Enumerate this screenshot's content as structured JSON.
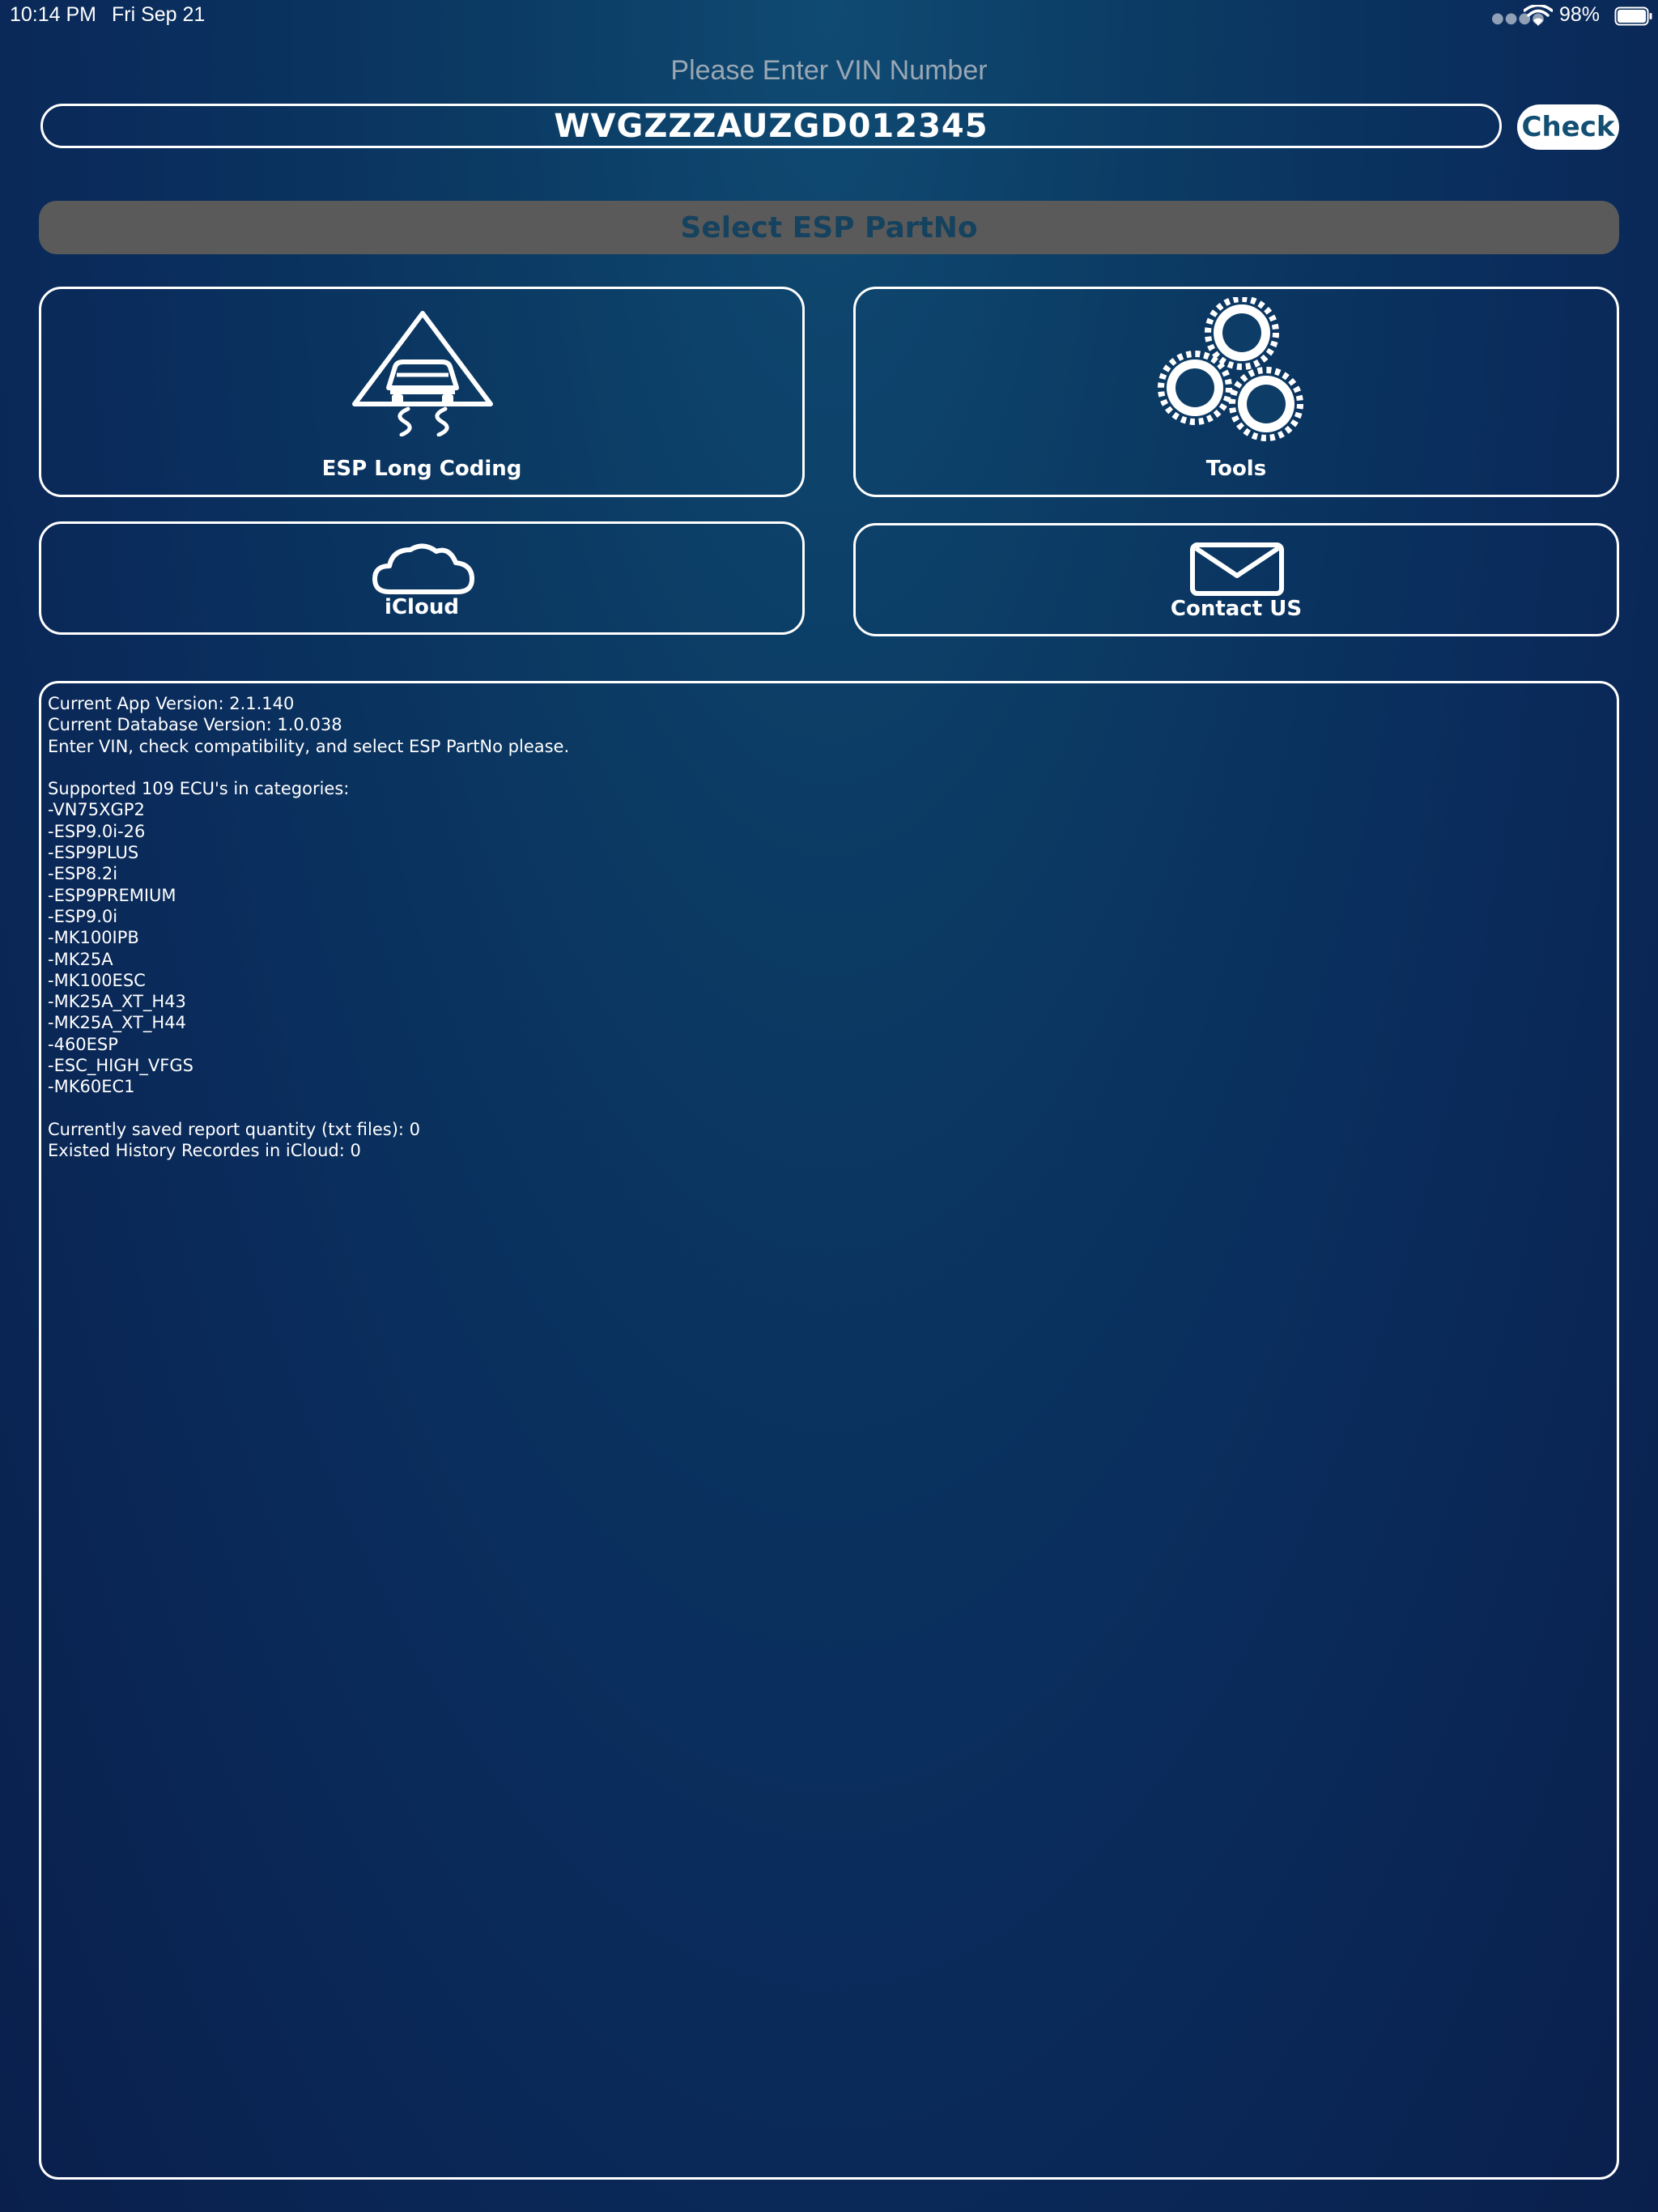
{
  "status_bar": {
    "time": "10:14 PM",
    "date": "Fri Sep 21",
    "battery": "98%",
    "wifi_icon": "wifi-icon",
    "battery_icon": "battery-icon"
  },
  "vin": {
    "prompt": "Please Enter VIN Number",
    "value": "WVGZZZAUZGD012345",
    "check_label": "Check"
  },
  "select_esp_label": "Select ESP PartNo",
  "tiles": {
    "esp_long_coding": {
      "label": "ESP Long Coding",
      "icon": "skid-warning-icon"
    },
    "tools": {
      "label": "Tools",
      "icon": "gears-icon"
    },
    "icloud": {
      "label": "iCloud",
      "icon": "cloud-icon"
    },
    "contact": {
      "label": "Contact US",
      "icon": "envelope-icon"
    }
  },
  "info_lines": [
    "Current App Version: 2.1.140",
    "Current Database Version: 1.0.038",
    "Enter VIN, check compatibility, and select ESP PartNo please.",
    "",
    "Supported 109 ECU's in categories:",
    "-VN75XGP2",
    "-ESP9.0i-26",
    "-ESP9PLUS",
    "-ESP8.2i",
    "-ESP9PREMIUM",
    "-ESP9.0i",
    "-MK100IPB",
    "-MK25A",
    "-MK100ESC",
    "-MK25A_XT_H43",
    "-MK25A_XT_H44",
    "-460ESP",
    "-ESC_HIGH_VFGS",
    "-MK60EC1",
    "",
    "Currently saved report quantity (txt files): 0",
    "Existed History Recordes in iCloud: 0"
  ],
  "colors": {
    "background_top": "#0f4a72",
    "background_bottom": "#0a1f4c",
    "accent_text": "#134f73",
    "select_bar": "#5a5a5a",
    "prompt_text": "#9aa7b4"
  }
}
